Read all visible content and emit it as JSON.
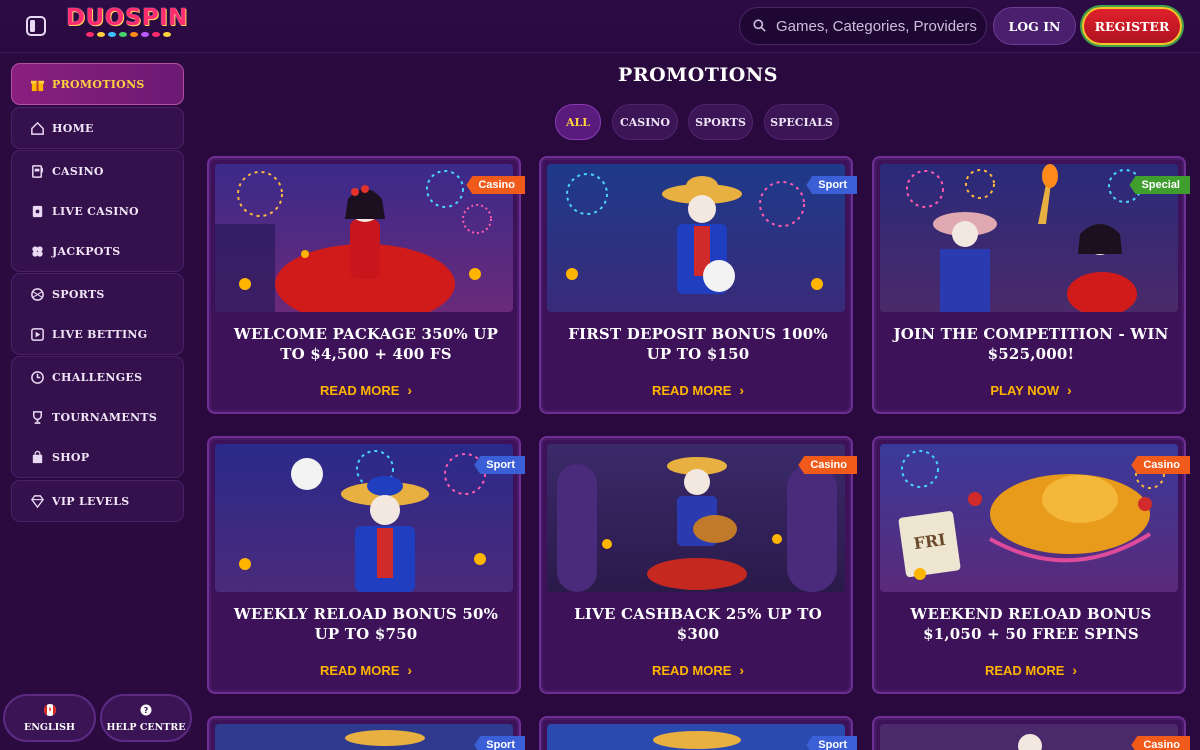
{
  "header": {
    "logo_text": "DUOSPIN",
    "search_placeholder": "Games, Categories, Providers",
    "login_label": "LOG IN",
    "register_label": "REGISTER"
  },
  "sidebar": {
    "promotions": "PROMOTIONS",
    "home": "HOME",
    "casino": "CASINO",
    "live_casino": "LIVE CASINO",
    "jackpots": "JACKPOTS",
    "sports": "SPORTS",
    "live_betting": "LIVE BETTING",
    "challenges": "CHALLENGES",
    "tournaments": "TOURNAMENTS",
    "shop": "SHOP",
    "vip_levels": "VIP LEVELS",
    "language": "ENGLISH",
    "help": "HELP CENTRE"
  },
  "main": {
    "title": "PROMOTIONS",
    "filters": [
      "ALL",
      "CASINO",
      "SPORTS",
      "SPECIALS"
    ]
  },
  "cards": [
    {
      "badge": "Casino",
      "title": "WELCOME PACKAGE 350% UP TO $4,500 + 400 FS",
      "cta": "READ MORE"
    },
    {
      "badge": "Sport",
      "title": "FIRST DEPOSIT BONUS 100% UP TO $150",
      "cta": "READ MORE"
    },
    {
      "badge": "Special",
      "title": "JOIN THE COMPETITION - WIN $525,000!",
      "cta": "PLAY NOW"
    },
    {
      "badge": "Sport",
      "title": "WEEKLY RELOAD BONUS 50% UP TO $750",
      "cta": "READ MORE"
    },
    {
      "badge": "Casino",
      "title": "LIVE CASHBACK 25% UP TO $300",
      "cta": "READ MORE"
    },
    {
      "badge": "Casino",
      "title": "WEEKEND RELOAD BONUS $1,050 + 50 FREE SPINS",
      "cta": "READ MORE"
    },
    {
      "badge": "Sport"
    },
    {
      "badge": "Sport"
    },
    {
      "badge": "Casino"
    }
  ],
  "colors": {
    "badge_casino": "#f05a1a",
    "badge_sport": "#3b5fd6",
    "badge_special": "#3f9e2e",
    "cta": "#ffb400",
    "active": "#ffd23f"
  }
}
